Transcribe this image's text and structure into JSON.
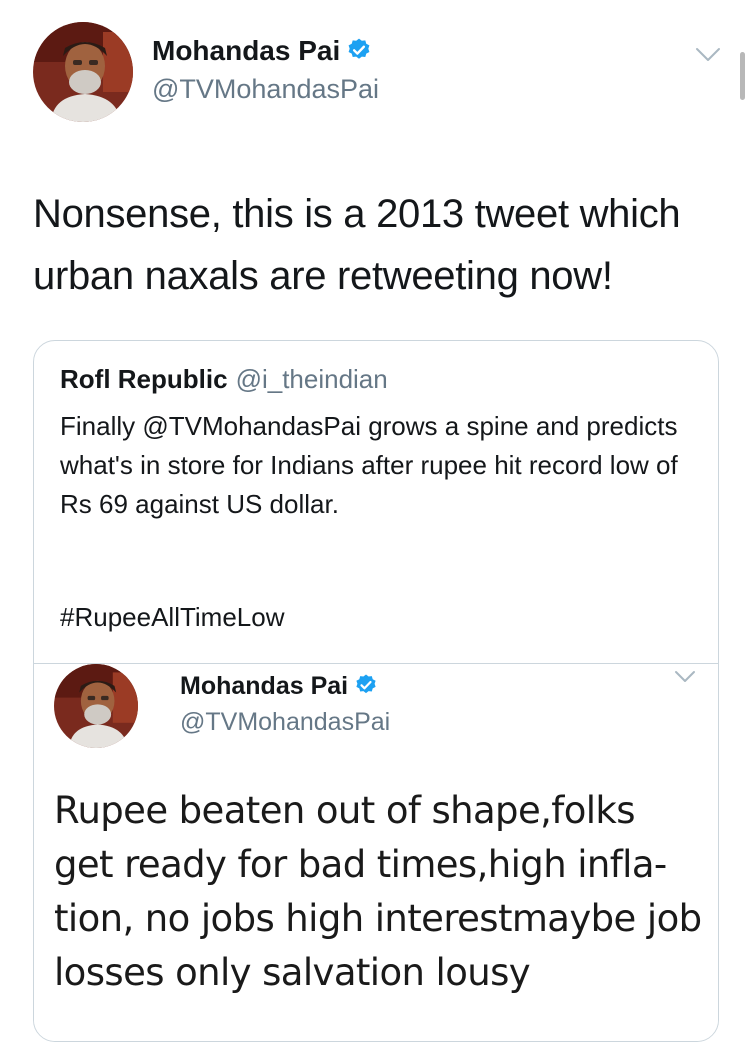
{
  "tweet": {
    "author": {
      "name": "Mohandas Pai",
      "handle": "@TVMohandasPai",
      "verified": true,
      "avatar_icon": "person-avatar-icon"
    },
    "text": "Nonsense, this is a 2013 tweet which urban naxals are retweeting now!",
    "menu_icon": "chevron-down-icon"
  },
  "quoted_tweet": {
    "author": {
      "name": "Rofl Republic",
      "handle": "@i_theindian"
    },
    "text": "Finally @TVMohandasPai grows a spine and predicts what's in store for Indians after rupee hit record low of Rs 69 against US dollar.",
    "hashtag": "#RupeeAllTimeLow",
    "embedded_screenshot": {
      "author": {
        "name": "Mohandas Pai",
        "handle": "@TVMohandasPai",
        "verified": true
      },
      "text": "Rupee beaten out of shape,folks get ready for bad times,high infla-tion, no jobs high interestmaybe job losses only salvation lousy"
    }
  },
  "colors": {
    "text": "#14171a",
    "secondary": "#657786",
    "verified_blue": "#1da1f2",
    "border": "#ccd6dd"
  }
}
